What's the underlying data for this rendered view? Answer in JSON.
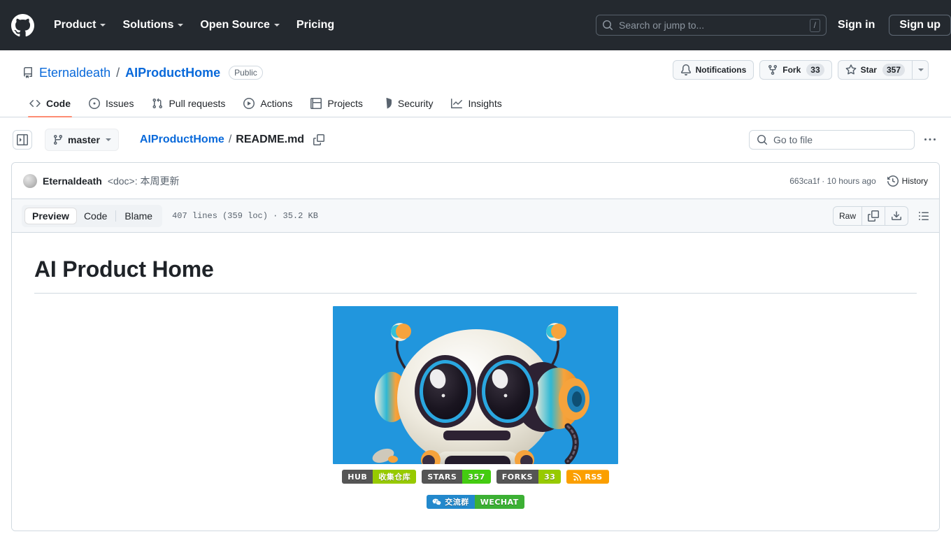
{
  "global_header": {
    "logo_name": "github-logo",
    "nav": [
      {
        "label": "Product",
        "has_caret": true
      },
      {
        "label": "Solutions",
        "has_caret": true
      },
      {
        "label": "Open Source",
        "has_caret": true
      },
      {
        "label": "Pricing",
        "has_caret": false
      }
    ],
    "search": {
      "placeholder": "Search or jump to...",
      "shortcut": "/"
    },
    "sign_in": "Sign in",
    "sign_up": "Sign up",
    "background": "#24292f"
  },
  "repo": {
    "owner": "Eternaldeath",
    "separator": "/",
    "name": "AIProductHome",
    "visibility": "Public",
    "actions": {
      "notifications": "Notifications",
      "fork_label": "Fork",
      "fork_count": "33",
      "star_label": "Star",
      "star_count": "357"
    },
    "tabs": [
      {
        "label": "Code",
        "icon": "code-icon",
        "active": true
      },
      {
        "label": "Issues",
        "icon": "issue-opened-icon",
        "active": false
      },
      {
        "label": "Pull requests",
        "icon": "git-pull-request-icon",
        "active": false
      },
      {
        "label": "Actions",
        "icon": "play-icon",
        "active": false
      },
      {
        "label": "Projects",
        "icon": "table-icon",
        "active": false
      },
      {
        "label": "Security",
        "icon": "shield-icon",
        "active": false
      },
      {
        "label": "Insights",
        "icon": "graph-icon",
        "active": false
      }
    ],
    "active_tab_underline_color": "#fd8c73"
  },
  "file_nav": {
    "sidebar_toggle_icon": "sidebar-expand-icon",
    "branch": "master",
    "breadcrumb": {
      "root": "AIProductHome",
      "separator": "/",
      "current": "README.md"
    },
    "copy_path_icon": "copy-icon",
    "go_to_file_placeholder": "Go to file",
    "more_options_icon": "kebab-horizontal-icon"
  },
  "commit": {
    "author": "Eternaldeath",
    "message": "<doc>: 本周更新",
    "sha": "663ca1f",
    "relative_time": "10 hours ago",
    "meta": "663ca1f · 10 hours ago",
    "history_label": "History"
  },
  "file_toolbar": {
    "views": [
      {
        "label": "Preview",
        "active": true
      },
      {
        "label": "Code",
        "active": false
      },
      {
        "label": "Blame",
        "active": false
      }
    ],
    "file_meta": "407 lines (359 loc) · 35.2 KB",
    "raw_label": "Raw",
    "copy_icon": "copy-icon",
    "download_icon": "download-icon",
    "outline_icon": "list-unordered-icon"
  },
  "readme": {
    "title": "AI Product Home",
    "hero_image": {
      "name": "robot-mascot-image",
      "alt": "3D cartoon robot mascot on blue background",
      "background_color": "#2196dd"
    },
    "badges_row1": [
      {
        "left": "HUB",
        "right": "收集仓库",
        "left_color": "#555555",
        "right_color": "#97ca00"
      },
      {
        "left": "STARS",
        "right": "357",
        "left_color": "#555555",
        "right_color": "#44cc11"
      },
      {
        "left": "FORKS",
        "right": "33",
        "left_color": "#555555",
        "right_color": "#97ca00"
      },
      {
        "left": "",
        "right": "RSS",
        "left_color": "",
        "right_color": "#fb9f00",
        "icon": "rss-icon",
        "solid": true
      }
    ],
    "badges_row2": [
      {
        "left": "交流群",
        "right": "WECHAT",
        "left_color": "#2288cc",
        "right_color": "#3cb034",
        "icon": "wechat-icon"
      }
    ]
  }
}
